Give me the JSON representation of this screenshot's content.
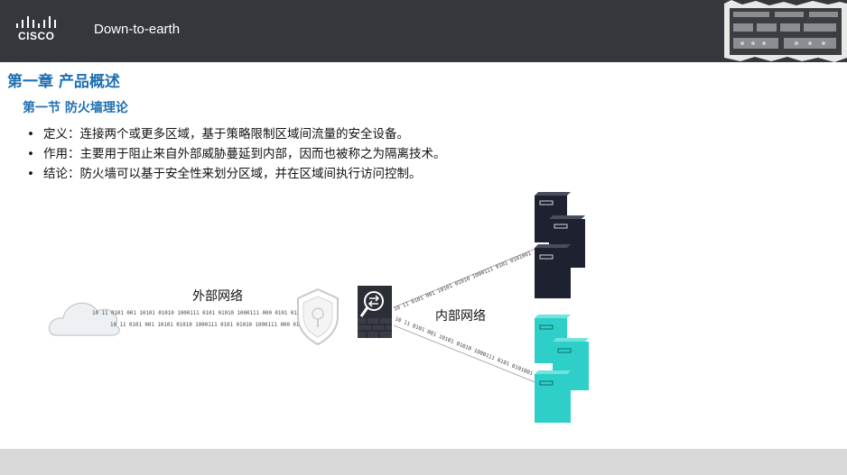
{
  "header": {
    "logo_text": "CISCO",
    "slogan": "Down-to-earth"
  },
  "chapter_title": "第一章 产品概述",
  "section_title": "第一节 防火墙理论",
  "bullets": [
    "定义：连接两个或更多区域，基于策略限制区域间流量的安全设备。",
    "作用：主要用于阻止来自外部威胁蔓延到内部，因而也被称之为隔离技术。",
    "结论：防火墙可以基于安全性来划分区域，并在区域间执行访问控制。"
  ],
  "diagram": {
    "outside_label": "外部网络",
    "inside_label": "内部网络",
    "bits_out_1": "10 11 0101 001 10101 01010 1000111 0101 01010 1000111 000 0101 01",
    "bits_out_2": "10 11 0101 001 10101 01010 1000111 0101 01010 1000111 000 0101 01",
    "bits_up": "10 11 0101 001 10101 01010 1000111 0101 0101001",
    "bits_down": "10 11 0101 001 10101 01010 1000111 0101 0101001"
  },
  "colors": {
    "header_bg": "#34373b",
    "title_blue": "#1f6fb3",
    "server_dark": "#1e2230",
    "server_teal": "#2ecfc8",
    "footer_bg": "#d9d9d9"
  }
}
